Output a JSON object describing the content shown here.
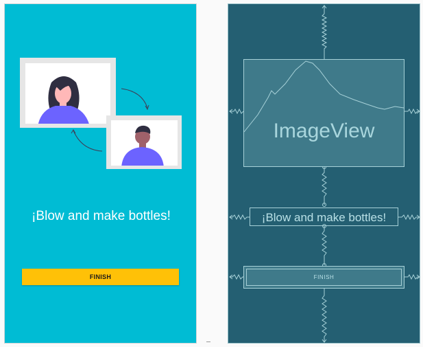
{
  "design": {
    "title": "¡Blow and make bottles!",
    "button_label": "FINISH"
  },
  "blueprint": {
    "imageview_label": "ImageView",
    "title": "¡Blow and make bottles!",
    "button_label": "FINISH"
  },
  "colors": {
    "design_bg": "#00bcd4",
    "blueprint_bg": "#245f72",
    "button": "#ffc107",
    "figure_purple": "#6c63ff",
    "hair": "#2f2e41"
  }
}
